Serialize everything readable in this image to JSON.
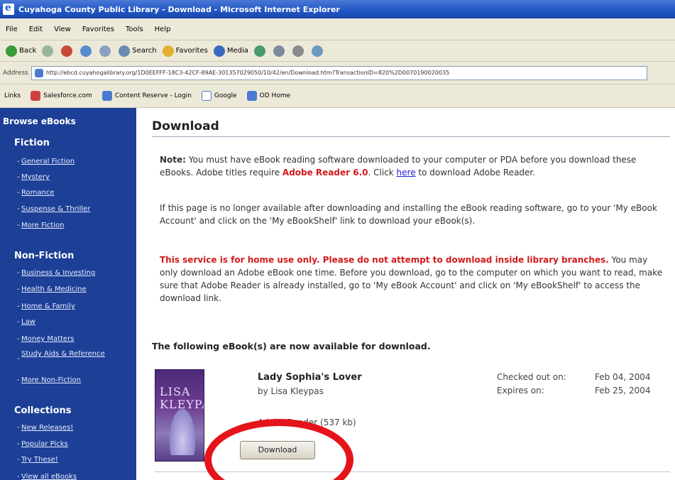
{
  "window": {
    "title": "Cuyahoga County Public Library - Download - Microsoft Internet Explorer"
  },
  "menu": [
    "File",
    "Edit",
    "View",
    "Favorites",
    "Tools",
    "Help"
  ],
  "toolbar": {
    "back": "Back",
    "search": "Search",
    "favorites": "Favorites",
    "media": "Media"
  },
  "address": {
    "label": "Address",
    "url": "http://ebcd.cuyahogalibrary.org/1D0EEFFF-18C3-42CF-89AE-301357029050/10/42/en/Download.htm?TransactionID=820%2D0070190020035"
  },
  "links": {
    "label": "Links",
    "items": [
      "Salesforce.com",
      "Content Reserve - Login",
      "Google",
      "OD Home"
    ]
  },
  "sidebar": {
    "title": "Browse eBooks",
    "fiction": {
      "heading": "Fiction",
      "items": [
        "General Fiction",
        "Mystery",
        "Romance",
        "Suspense & Thriller",
        "More Fiction"
      ]
    },
    "nonfiction": {
      "heading": "Non-Fiction",
      "items": [
        "Business & Investing",
        "Health & Medicine",
        "Home & Family",
        "Law",
        "Money Matters",
        "Study Aids & Reference",
        "More Non-Fiction"
      ]
    },
    "collections": {
      "heading": "Collections",
      "items": [
        "New Releases!",
        "Popular Picks",
        "Try These!",
        "View all eBooks"
      ]
    }
  },
  "main": {
    "title": "Download",
    "note_label": "Note:",
    "note_text": " You must have eBook reading software downloaded to your computer or PDA before you download these eBooks. Adobe titles require ",
    "adobe_req": "Adobe Reader 6.0",
    "note_text2": ". Click ",
    "here_link": "here",
    "note_text3": " to download Adobe Reader.",
    "para2": "If this page is no longer available after downloading and installing the eBook reading software, go to your 'My eBook Account' and click on the 'My eBookShelf' link to download your eBook(s).",
    "warning": "This service is for home use only. Please do not attempt to download inside library branches.",
    "para3": " You may only download an Adobe eBook one time. Before you download, go to the computer on which you want to read, make sure that Adobe Reader is already installed, go to 'My eBook Account' and click on 'My eBookShelf' to access the download link.",
    "available": "The following eBook(s) are now available for download."
  },
  "book": {
    "cover_author": "LISA KLEYPAS",
    "title": "Lady Sophia's Lover",
    "author": "by Lisa Kleypas",
    "checked_out_label": "Checked out on:",
    "checked_out_date": "Feb 04, 2004",
    "expires_label": "Expires on:",
    "expires_date": "Feb 25, 2004",
    "format": "Adobe Reader (537 kb)",
    "download_label": "Download"
  },
  "colors": {
    "sidebar": "#1d3f96",
    "warning": "#d21a1a",
    "annotation": "#e5141a"
  }
}
